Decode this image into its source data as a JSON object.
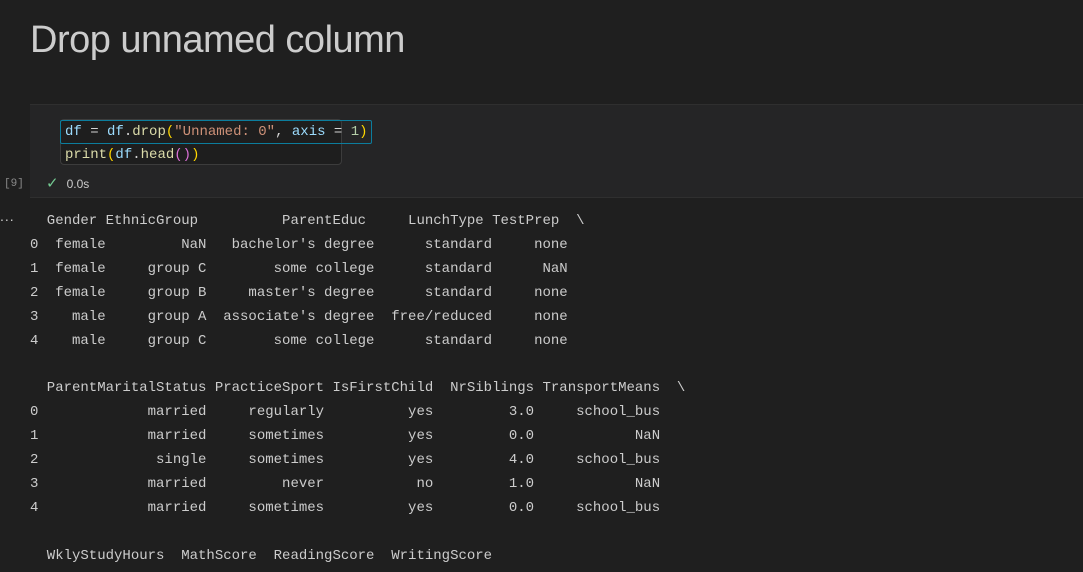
{
  "heading": "Drop unnamed column",
  "cell": {
    "execution_count": "[9]",
    "duration": "0.0s",
    "code": {
      "line1": {
        "df": "df",
        "assign": " = ",
        "df2": "df",
        "dot": ".",
        "fn": "drop",
        "open": "(",
        "arg_str": "\"Unnamed: 0\"",
        "comma": ", ",
        "kw": "axis",
        "eq": " = ",
        "num": "1",
        "close": ")"
      },
      "line2": {
        "fn": "print",
        "open": "(",
        "var": "df",
        "dot": ".",
        "method": "head",
        "inner_open": "(",
        "inner_close": ")",
        "close": ")"
      }
    }
  },
  "output": {
    "more_icon": "...",
    "lines": [
      "  Gender EthnicGroup          ParentEduc     LunchType TestPrep  \\",
      "0  female         NaN   bachelor's degree      standard     none",
      "1  female     group C        some college      standard      NaN",
      "2  female     group B     master's degree      standard     none",
      "3    male     group A  associate's degree  free/reduced     none",
      "4    male     group C        some college      standard     none",
      "",
      "  ParentMaritalStatus PracticeSport IsFirstChild  NrSiblings TransportMeans  \\",
      "0             married     regularly          yes         3.0     school_bus",
      "1             married     sometimes          yes         0.0            NaN",
      "2              single     sometimes          yes         4.0     school_bus",
      "3             married         never           no         1.0            NaN",
      "4             married     sometimes          yes         0.0     school_bus",
      "",
      "  WklyStudyHours  MathScore  ReadingScore  WritingScore"
    ]
  }
}
